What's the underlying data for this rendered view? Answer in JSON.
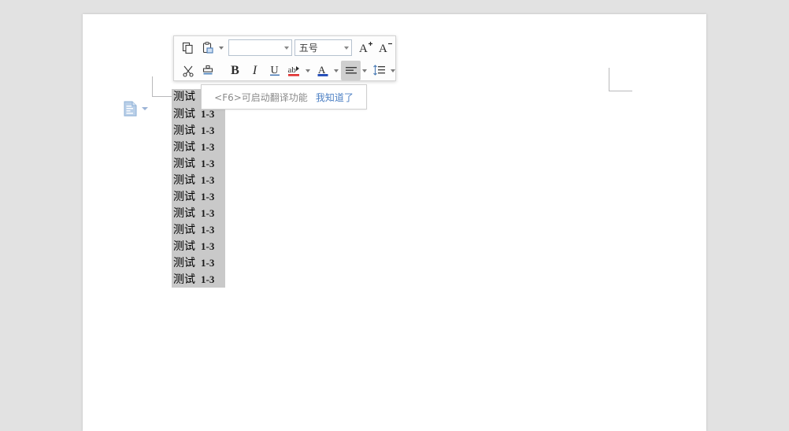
{
  "app": {
    "background_color": "#e2e2e2",
    "page_color": "#ffffff"
  },
  "toolbar": {
    "name": "floating-mini-toolbar",
    "font_name": {
      "value": "",
      "placeholder": ""
    },
    "font_size": {
      "value": "五号"
    },
    "buttons": {
      "copy": "copy-icon",
      "paste": "paste-icon",
      "paste_caret": "chevron-down-icon",
      "grow_font": "A",
      "grow_font_sup": "+",
      "shrink_font": "A",
      "shrink_font_sup": "−",
      "cut": "cut-icon",
      "format_painter": "format-painter-icon",
      "bold": "B",
      "italic": "I",
      "underline": "U",
      "highlight": "ab",
      "font_color": "A",
      "align": "align-left-icon",
      "line_spacing": "line-spacing-icon"
    },
    "align_active": true
  },
  "tooltip": {
    "message": "<F6>可启动翻译功能",
    "action_label": "我知道了"
  },
  "smart_tag": {
    "name": "paste-options",
    "icon": "paste-options-icon",
    "caret": "chevron-down-icon"
  },
  "document": {
    "selection_color": "#c9c9c9",
    "lines": [
      {
        "cn": "测试",
        "num": ""
      },
      {
        "cn": "测试",
        "num": "1-3"
      },
      {
        "cn": "测试",
        "num": "1-3"
      },
      {
        "cn": "测试",
        "num": "1-3"
      },
      {
        "cn": "测试",
        "num": "1-3"
      },
      {
        "cn": "测试",
        "num": "1-3"
      },
      {
        "cn": "测试",
        "num": "1-3"
      },
      {
        "cn": "测试",
        "num": "1-3"
      },
      {
        "cn": "测试",
        "num": "1-3"
      },
      {
        "cn": "测试",
        "num": "1-3"
      },
      {
        "cn": "测试",
        "num": "1-3"
      },
      {
        "cn": "测试",
        "num": "1-3"
      }
    ]
  }
}
